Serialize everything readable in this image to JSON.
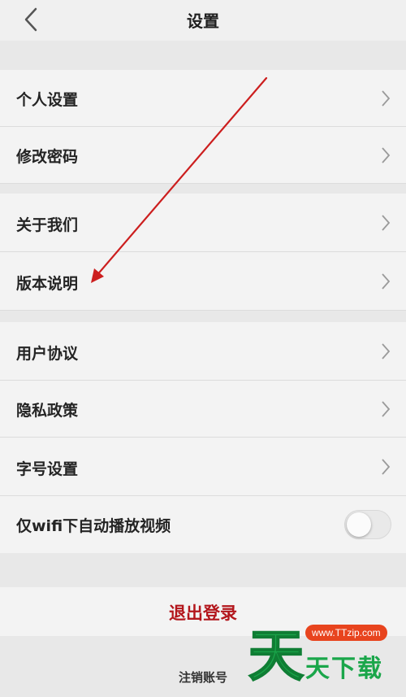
{
  "header": {
    "title": "设置",
    "back_icon": "chevron-left-icon"
  },
  "groups": [
    {
      "items": [
        {
          "label": "个人设置"
        },
        {
          "label": "修改密码"
        }
      ]
    },
    {
      "items": [
        {
          "label": "关于我们"
        },
        {
          "label": "版本说明"
        }
      ]
    },
    {
      "items": [
        {
          "label": "用户协议"
        },
        {
          "label": "隐私政策"
        },
        {
          "label": "字号设置"
        }
      ]
    }
  ],
  "wifi_autoplay": {
    "label": "仅wifi下自动播放视频",
    "enabled": false
  },
  "logout": {
    "label": "退出登录",
    "color": "#b3161c"
  },
  "cancel_account": {
    "label": "注销账号"
  },
  "watermark": {
    "site": "www.TTzip.com",
    "big_char": "天",
    "sub_text": "天下载"
  },
  "annotation": {
    "type": "red-arrow",
    "color": "#cc1e1e",
    "points_to": "版本说明"
  },
  "colors": {
    "background": "#e8e8e8",
    "row": "#f3f3f3",
    "accent_green": "#1aa64a"
  }
}
